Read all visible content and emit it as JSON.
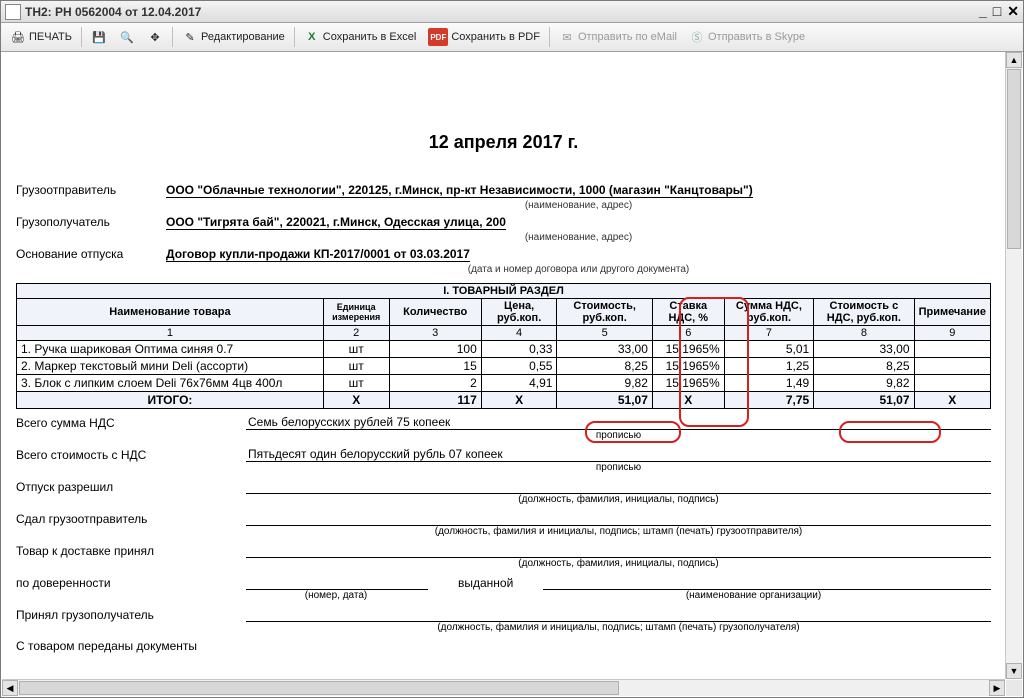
{
  "window": {
    "title": "ТН2: РН 0562004 от 12.04.2017"
  },
  "toolbar": {
    "print": "ПЕЧАТЬ",
    "edit": "Редактирование",
    "save_excel": "Сохранить в Excel",
    "save_pdf": "Сохранить в PDF",
    "send_email": "Отправить по eMail",
    "send_skype": "Отправить в Skype"
  },
  "doc": {
    "date_heading": "12 апреля 2017 г.",
    "sender_label": "Грузоотправитель",
    "sender_value": "ООО \"Облачные технологии\",  220125, г.Минск, пр-кт Независимости, 1000 (магазин \"Канцтовары\")",
    "receiver_label": "Грузополучатель",
    "receiver_value": "ООО \"Тигрята бай\",  220021, г.Минск, Одесская улица, 200",
    "basis_label": "Основание отпуска",
    "basis_value": "Договор купли-продажи КП-2017/0001 от 03.03.2017",
    "sub_name_addr": "(наименование, адрес)",
    "sub_doc": "(дата и номер договора или другого документа)",
    "section_title": "I. ТОВАРНЫЙ РАЗДЕЛ",
    "columns": {
      "c1": "Наименование товара",
      "c2": "Единица измерения",
      "c3": "Количество",
      "c4": "Цена, руб.коп.",
      "c5": "Стоимость, руб.коп.",
      "c6": "Ставка НДС, %",
      "c7": "Сумма НДС, руб.коп.",
      "c8": "Стоимость с НДС, руб.коп.",
      "c9": "Примечание"
    },
    "col_nums": {
      "n1": "1",
      "n2": "2",
      "n3": "3",
      "n4": "4",
      "n5": "5",
      "n6": "6",
      "n7": "7",
      "n8": "8",
      "n9": "9"
    },
    "rows": [
      {
        "name": "1. Ручка шариковая Оптима синяя 0.7",
        "unit": "шт",
        "qty": "100",
        "price": "0,33",
        "cost": "33,00",
        "vat_rate": "15,1965%",
        "vat_sum": "5,01",
        "total": "33,00"
      },
      {
        "name": "2. Маркер текстовый мини Deli (ассорти)",
        "unit": "шт",
        "qty": "15",
        "price": "0,55",
        "cost": "8,25",
        "vat_rate": "15,1965%",
        "vat_sum": "1,25",
        "total": "8,25"
      },
      {
        "name": "3. Блок с липким слоем Deli 76х76мм 4цв 400л",
        "unit": "шт",
        "qty": "2",
        "price": "4,91",
        "cost": "9,82",
        "vat_rate": "15,1965%",
        "vat_sum": "1,49",
        "total": "9,82"
      }
    ],
    "totals": {
      "label": "ИТОГО:",
      "x": "X",
      "qty": "117",
      "cost": "51,07",
      "vat_sum": "7,75",
      "total": "51,07"
    },
    "footer": {
      "vat_sum_label": "Всего сумма НДС",
      "vat_sum_text": "Семь белорусских рублей 75 копеек",
      "total_label": "Всего стоимость с НДС",
      "total_text": "Пятьдесят один белорусский рубль 07 копеек",
      "released_label": "Отпуск разрешил",
      "sender_handed_label": "Сдал грузоотправитель",
      "accepted_label": "Товар к доставке принял",
      "proxy_label": "по доверенности",
      "receiver_accepted_label": "Принял грузополучатель",
      "docs_label": "С товаром переданы документы",
      "sub_words": "прописью",
      "sub_sign1": "(должность, фамилия, инициалы, подпись)",
      "sub_sign2": "(должность, фамилия и инициалы, подпись; штамп (печать) грузоотправителя)",
      "sub_sign3": "(должность, фамилия, инициалы, подпись)",
      "sub_proxy_num": "(номер, дата)",
      "sub_proxy_issued": "выданной",
      "sub_proxy_org": "(наименование организации)",
      "sub_sign4": "(должность, фамилия и инициалы, подпись; штамп (печать) грузополучателя)"
    }
  }
}
